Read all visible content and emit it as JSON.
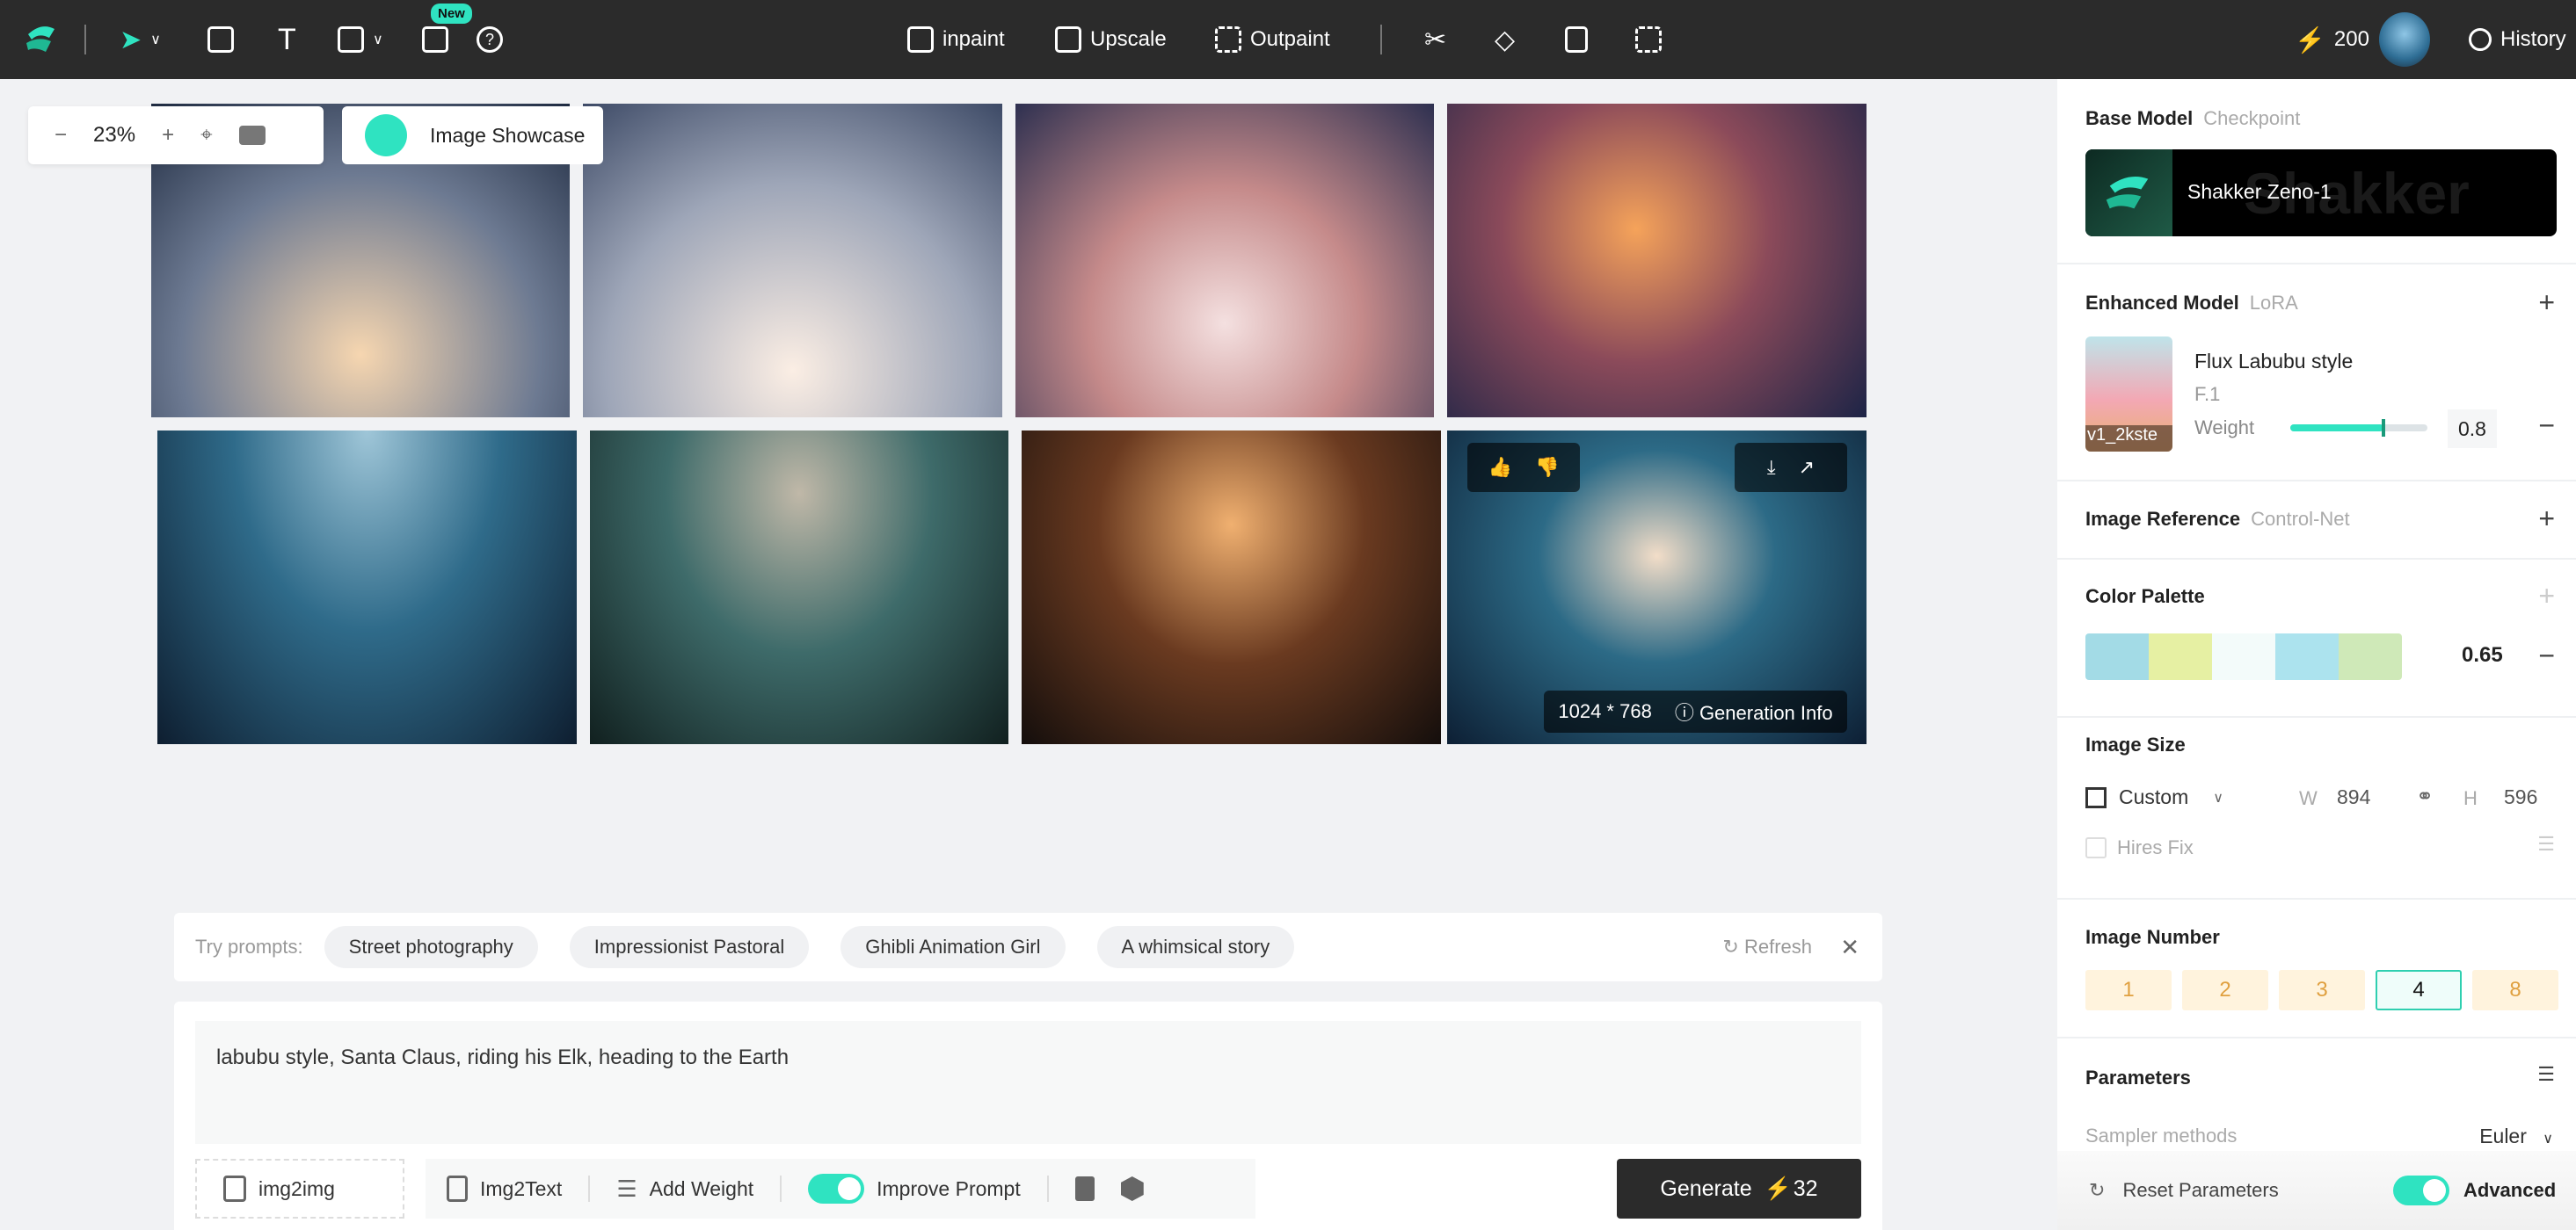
{
  "topbar": {
    "new_badge": "New",
    "inpaint": "inpaint",
    "upscale": "Upscale",
    "outpaint": "Outpaint",
    "credits": "200",
    "history": "History"
  },
  "canvas": {
    "zoom": "23%",
    "showcase_label": "Image Showcase",
    "image_size": "1024 * 768",
    "generation_info": "Generation Info"
  },
  "prompts": {
    "label": "Try prompts:",
    "chips": [
      "Street photography",
      "Impressionist Pastoral",
      "Ghibli Animation Girl",
      "A whimsical story"
    ],
    "refresh": "Refresh"
  },
  "prompt_box": {
    "text": "labubu style, Santa Claus, riding his Elk, heading to the Earth",
    "img2img": "img2img",
    "img2text": "Img2Text",
    "add_weight": "Add Weight",
    "improve_prompt": "Improve Prompt",
    "improve_on": true,
    "generate": "Generate",
    "generate_cost": "32"
  },
  "panel": {
    "base_model": {
      "title": "Base Model",
      "sub": "Checkpoint",
      "name": "Shakker Zeno-1",
      "watermark": "Shakker"
    },
    "enhanced": {
      "title": "Enhanced Model",
      "sub": "LoRA",
      "name": "Flux Labubu style",
      "version": "F.1",
      "thumb_label": "v1_2kste",
      "weight_label": "Weight",
      "weight": "0.8",
      "weight_value": 0.8
    },
    "reference": {
      "title": "Image Reference",
      "sub": "Control-Net"
    },
    "palette": {
      "title": "Color Palette",
      "colors": [
        "#a3dbe6",
        "#e6f0a3",
        "#f3fbfa",
        "#ace3ee",
        "#cfe9b8"
      ],
      "value": "0.65"
    },
    "size": {
      "title": "Image Size",
      "preset": "Custom",
      "w_label": "W",
      "w": "894",
      "h_label": "H",
      "h": "596",
      "hires": "Hires Fix"
    },
    "number": {
      "title": "Image Number",
      "options": [
        "1",
        "2",
        "3",
        "4",
        "8"
      ],
      "selected": "4"
    },
    "params": {
      "title": "Parameters",
      "sampler_label": "Sampler methods",
      "sampler": "Euler",
      "reset": "Reset Parameters",
      "advanced": "Advanced",
      "advanced_on": true
    }
  },
  "colors": {
    "accent": "#2fe3c1",
    "dark": "#2b2b2b",
    "credit": "#f7c24a"
  }
}
